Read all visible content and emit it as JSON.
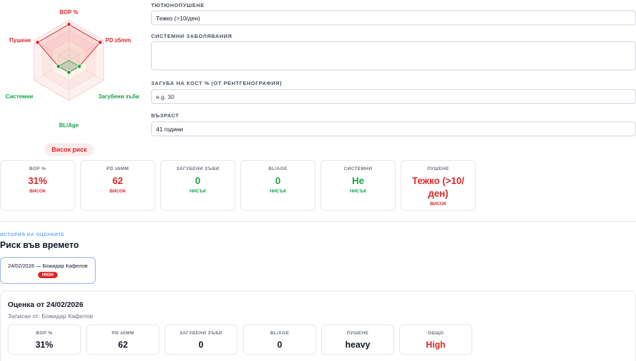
{
  "radar": {
    "axes": [
      {
        "label": "BOP %",
        "value": 0.9,
        "tone": "red"
      },
      {
        "label": "PD ≥5mm",
        "value": 0.9,
        "tone": "red"
      },
      {
        "label": "Загубени зъби",
        "value": 0.3,
        "tone": "green"
      },
      {
        "label": "BL/Age",
        "value": 0.3,
        "tone": "green"
      },
      {
        "label": "Системни",
        "value": 0.3,
        "tone": "green"
      },
      {
        "label": "Пушене",
        "value": 0.9,
        "tone": "red"
      }
    ],
    "colors": {
      "red": "#dc2626",
      "green": "#16a34a"
    }
  },
  "risk_pill": "Висок риск",
  "form": {
    "smoking_label": "Тютюнопушене",
    "smoking_value": "Тежко (>10/ден)",
    "systemic_label": "Системни заболявания",
    "systemic_value": "",
    "boneloss_label": "Загуба на кост % (от рентгенография)",
    "boneloss_placeholder": "e.g. 30",
    "age_label": "Възраст",
    "age_value": "41 години"
  },
  "metrics": [
    {
      "title": "BOP %",
      "value": "31%",
      "level": "ВИСОК",
      "tone": "red"
    },
    {
      "title": "PD ≥5MM",
      "value": "62",
      "level": "ВИСОК",
      "tone": "red"
    },
    {
      "title": "Загубени зъби",
      "value": "0",
      "level": "НИСЪК",
      "tone": "green"
    },
    {
      "title": "BL/AGE",
      "value": "0",
      "level": "НИСЪК",
      "tone": "green"
    },
    {
      "title": "Системни",
      "value": "Не",
      "level": "НИСЪК",
      "tone": "green"
    },
    {
      "title": "Пушене",
      "value": "Тежко (>10/ден)",
      "level": "ВИСОК",
      "tone": "red"
    }
  ],
  "history": {
    "eyebrow": "История на оценките",
    "title": "Риск във времето",
    "chip_text": "24/02/2026 — Божидар Кафелов",
    "chip_badge": "HIGH"
  },
  "assessment": {
    "title": "Оценка от 24/02/2026",
    "subtitle": "Записан от: Божидар Кафелов",
    "cards": [
      {
        "title": "BOP %",
        "value": "31%"
      },
      {
        "title": "PD ≥5MM",
        "value": "62"
      },
      {
        "title": "Загубени зъби",
        "value": "0"
      },
      {
        "title": "BL/AGE",
        "value": "0"
      },
      {
        "title": "Пушене",
        "value": "heavy"
      },
      {
        "title": "Общо",
        "value": "High"
      }
    ]
  }
}
